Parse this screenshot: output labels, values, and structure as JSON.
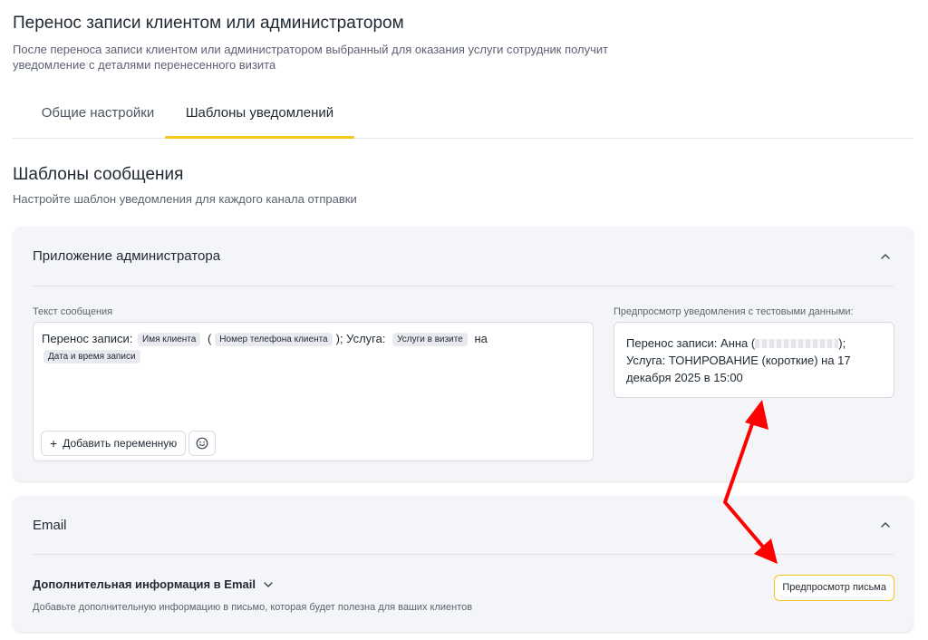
{
  "header": {
    "title": "Перенос записи клиентом или администратором",
    "description": "После переноса записи клиентом или администратором выбранный для оказания услуги сотрудник получит уведомление с деталями перенесенного визита"
  },
  "tabs": [
    {
      "label": "Общие настройки",
      "active": false
    },
    {
      "label": "Шаблоны уведомлений",
      "active": true
    }
  ],
  "section": {
    "title": "Шаблоны сообщения",
    "description": "Настройте шаблон уведомления для каждого канала отправки"
  },
  "admin_app": {
    "title": "Приложение администратора",
    "message_label": "Текст сообщения",
    "message": {
      "part1": "Перенос записи:",
      "chip_client_name": "Имя клиента",
      "part2": "(",
      "chip_client_phone": "Номер телефона клиента",
      "part3": "); Услуга:",
      "chip_services": "Услуги в визите",
      "part4": "на",
      "chip_datetime": "Дата и время записи"
    },
    "add_variable_label": "Добавить переменную",
    "preview_label": "Предпросмотр уведомления с тестовыми данными:",
    "preview": {
      "part1": "Перенос записи: Анна (",
      "part2": ");",
      "part3": "Услуга: ТОНИРОВАНИЕ (короткие) на 17 декабря 2025 в 15:00"
    }
  },
  "email": {
    "title": "Email",
    "extra_title": "Дополнительная информация в Email",
    "extra_desc": "Добавьте дополнительную информацию в письмо, которая будет полезна для ваших клиентов",
    "preview_button": "Предпросмотр письма"
  },
  "colors": {
    "accent": "#f5c518",
    "annotation_arrow": "#ff0000",
    "card_bg": "#f4f5f8"
  }
}
